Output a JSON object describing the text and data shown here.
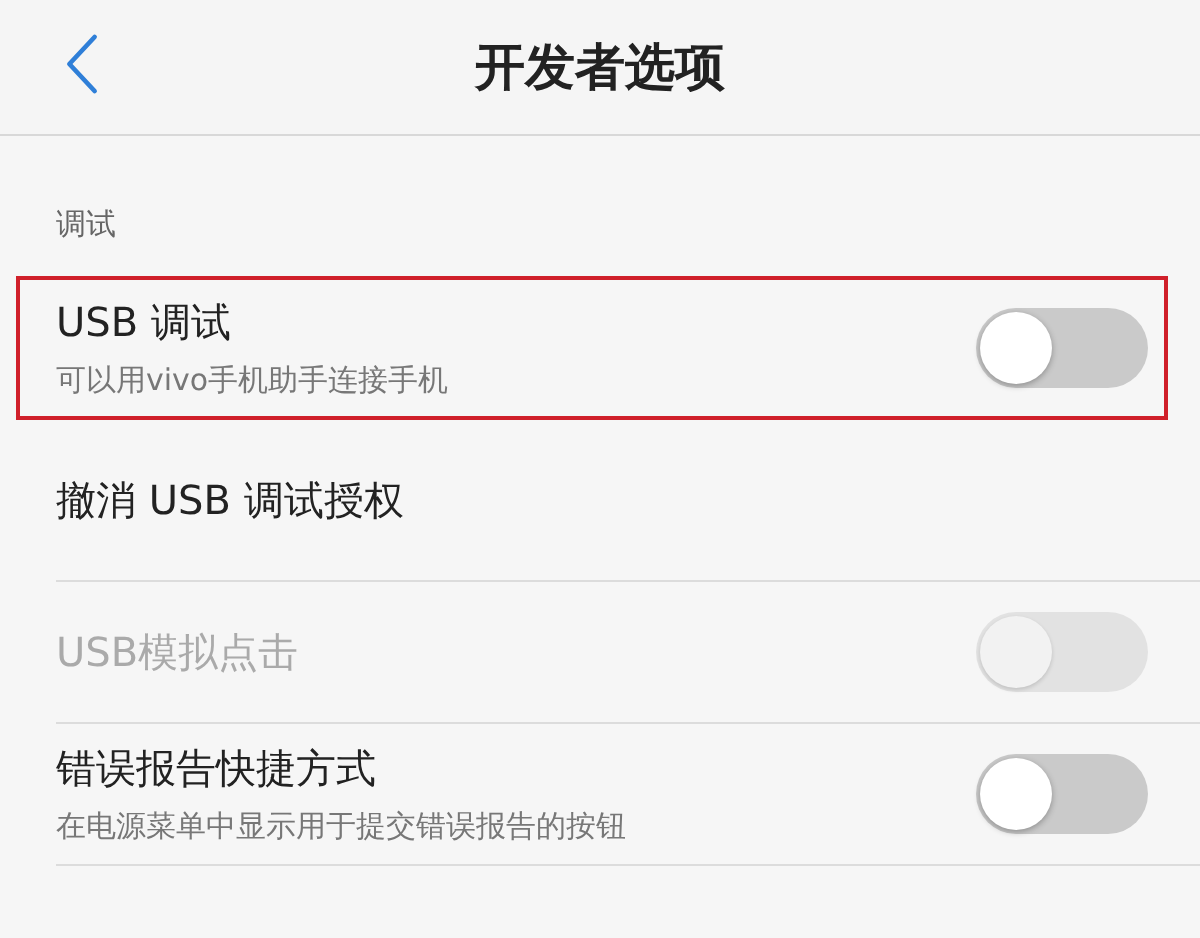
{
  "header": {
    "title": "开发者选项"
  },
  "section": {
    "title": "调试"
  },
  "items": [
    {
      "kind": "toggle",
      "title": "USB 调试",
      "subtitle": "可以用vivo手机助手连接手机",
      "on": false,
      "disabled": false,
      "highlighted": true
    },
    {
      "kind": "action",
      "title": "撤消 USB 调试授权",
      "disabled": false,
      "highlighted": false
    },
    {
      "kind": "toggle",
      "title": "USB模拟点击",
      "on": false,
      "disabled": true,
      "highlighted": false
    },
    {
      "kind": "toggle",
      "title": "错误报告快捷方式",
      "subtitle": "在电源菜单中显示用于提交错误报告的按钮",
      "on": false,
      "disabled": false,
      "highlighted": false
    }
  ]
}
